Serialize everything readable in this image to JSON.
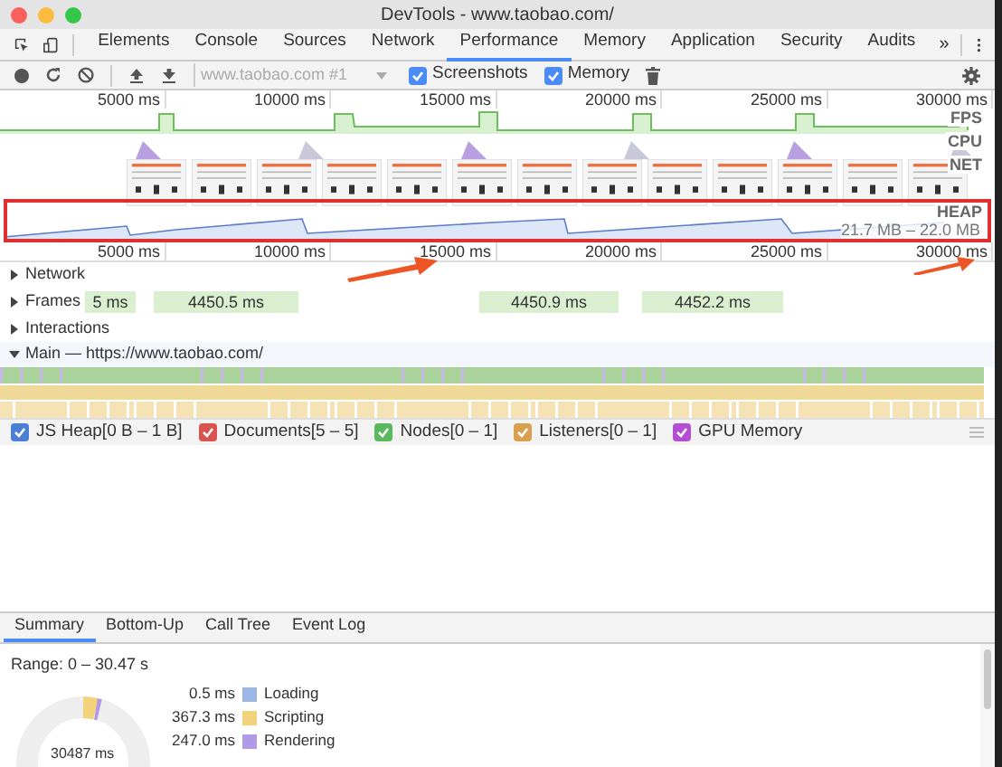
{
  "window": {
    "title": "DevTools - www.taobao.com/"
  },
  "tabs": [
    {
      "label": "Elements",
      "selected": false
    },
    {
      "label": "Console",
      "selected": false
    },
    {
      "label": "Sources",
      "selected": false
    },
    {
      "label": "Network",
      "selected": false
    },
    {
      "label": "Performance",
      "selected": true
    },
    {
      "label": "Memory",
      "selected": false
    },
    {
      "label": "Application",
      "selected": false
    },
    {
      "label": "Security",
      "selected": false
    },
    {
      "label": "Audits",
      "selected": false
    }
  ],
  "more_tabs": "»",
  "toolbar": {
    "recording_select": {
      "value": "www.taobao.com #1"
    },
    "checkboxes": [
      {
        "label": "Screenshots",
        "checked": true
      },
      {
        "label": "Memory",
        "checked": true
      }
    ]
  },
  "overview": {
    "ticks": [
      "5000 ms",
      "10000 ms",
      "15000 ms",
      "20000 ms",
      "25000 ms",
      "30000 ms"
    ],
    "tracks": [
      "FPS",
      "CPU",
      "NET",
      "HEAP"
    ],
    "heap_range": "21.7 MB – 22.0 MB"
  },
  "timeline": {
    "ticks": [
      "5000 ms",
      "10000 ms",
      "15000 ms",
      "20000 ms",
      "25000 ms",
      "30000 ms"
    ],
    "tracks": [
      {
        "label": "Network",
        "expanded": false
      },
      {
        "label": "Frames",
        "expanded": false
      },
      {
        "label": "Interactions",
        "expanded": false
      },
      {
        "label": "Main — https://www.taobao.com/",
        "expanded": true
      }
    ],
    "frames": [
      "5 ms",
      "4450.5 ms",
      "4450.9 ms",
      "4452.2 ms"
    ]
  },
  "counters": [
    {
      "label": "JS Heap[0 B – 1 B]",
      "checked": true,
      "color": "#4a7fd4"
    },
    {
      "label": "Documents[5 – 5]",
      "checked": true,
      "color": "#d9534f"
    },
    {
      "label": "Nodes[0 – 1]",
      "checked": true,
      "color": "#5cb85c"
    },
    {
      "label": "Listeners[0 – 1]",
      "checked": true,
      "color": "#d9a04f"
    },
    {
      "label": "GPU Memory",
      "checked": true,
      "color": "#b44fd4"
    }
  ],
  "bottom_tabs": [
    {
      "label": "Summary",
      "selected": true
    },
    {
      "label": "Bottom-Up",
      "selected": false
    },
    {
      "label": "Call Tree",
      "selected": false
    },
    {
      "label": "Event Log",
      "selected": false
    }
  ],
  "summary": {
    "range": "Range: 0 – 30.47 s",
    "total": "30487 ms",
    "items": [
      {
        "value": "0.5 ms",
        "label": "Loading",
        "color": "#9ab8e6"
      },
      {
        "value": "367.3 ms",
        "label": "Scripting",
        "color": "#f2d27a"
      },
      {
        "value": "247.0 ms",
        "label": "Rendering",
        "color": "#b09ae6"
      }
    ]
  }
}
